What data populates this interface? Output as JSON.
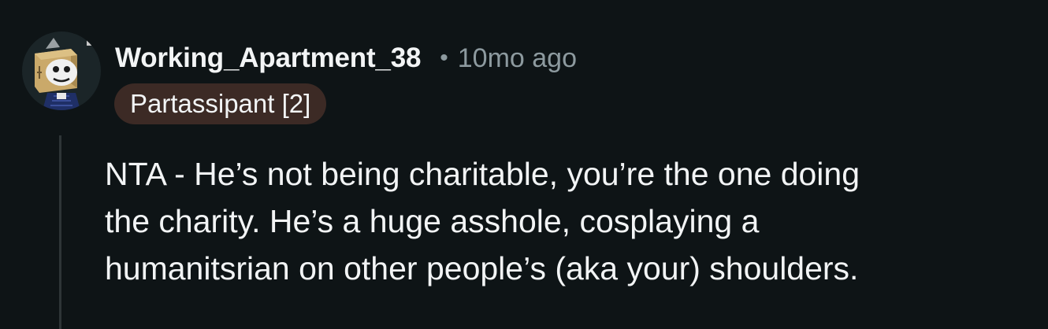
{
  "comment": {
    "avatar_icon": "snoo-box-head-avatar-icon",
    "username": "Working_Apartment_38",
    "separator": "•",
    "timestamp": "10mo ago",
    "flair": "Partassipant [2]",
    "flair_color": "#3c2a25",
    "body_lines": [
      "NTA - He’s not being charitable, you’re the one doing",
      "the charity. He’s a huge asshole, cosplaying a",
      "humanitsrian on other people’s (aka your) shoulders."
    ]
  },
  "colors": {
    "background": "#0e1416",
    "text_primary": "#f2f4f5",
    "text_secondary": "#8d9a9f",
    "thread_line": "#2e3537"
  }
}
